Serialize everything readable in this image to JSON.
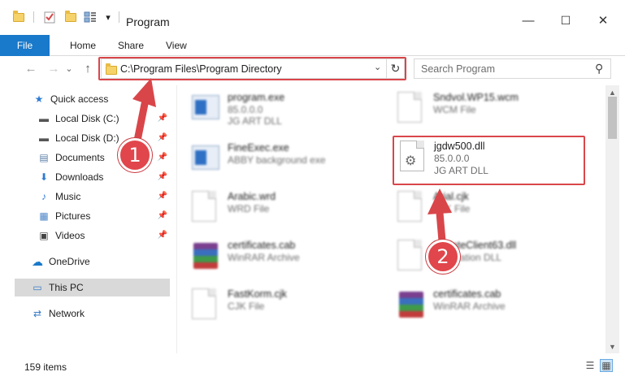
{
  "window": {
    "title": "Program",
    "minimize": "—",
    "maximize": "☐",
    "close": "✕"
  },
  "quick_access_toolbar": {
    "dropdown": "▾"
  },
  "ribbon": {
    "tabs": [
      "File",
      "Home",
      "Share",
      "View"
    ]
  },
  "navigation": {
    "back": "←",
    "forward": "→",
    "recent": "⌄",
    "up": "↑"
  },
  "address": {
    "path": "C:\\Program Files\\Program Directory",
    "dropdown": "⌄",
    "refresh": "↻"
  },
  "search": {
    "placeholder": "Search Program",
    "icon": "⚲"
  },
  "sidebar": {
    "items": [
      {
        "label": "Quick access",
        "icon": "star-icon",
        "glyph": "★",
        "pinned": false
      },
      {
        "label": "Local Disk (C:)",
        "icon": "drive-icon",
        "glyph": "▬",
        "pinned": true
      },
      {
        "label": "Local Disk (D:)",
        "icon": "drive-icon",
        "glyph": "▬",
        "pinned": true
      },
      {
        "label": "Documents",
        "icon": "documents-icon",
        "glyph": "▤",
        "pinned": true
      },
      {
        "label": "Downloads",
        "icon": "download-icon",
        "glyph": "⬇",
        "pinned": true
      },
      {
        "label": "Music",
        "icon": "music-icon",
        "glyph": "♪",
        "pinned": true
      },
      {
        "label": "Pictures",
        "icon": "pictures-icon",
        "glyph": "▦",
        "pinned": true
      },
      {
        "label": "Videos",
        "icon": "videos-icon",
        "glyph": "▣",
        "pinned": true
      },
      {
        "label": "OneDrive",
        "icon": "cloud-icon",
        "glyph": "☁",
        "pinned": false
      },
      {
        "label": "This PC",
        "icon": "computer-icon",
        "glyph": "▭",
        "pinned": false
      },
      {
        "label": "Network",
        "icon": "network-icon",
        "glyph": "⇄",
        "pinned": false
      }
    ],
    "pin_glyph": "📌"
  },
  "files": [
    {
      "name": "program.exe",
      "line1": "85.0.0.0",
      "line2": "JG ART DLL",
      "icon": "exe-icon"
    },
    {
      "name": "Sndvol.WP15.wcm",
      "line1": "WCM File",
      "line2": "",
      "icon": "file-icon"
    },
    {
      "name": "FineExec.exe",
      "line1": "ABBY background exe",
      "line2": "",
      "icon": "exe-icon"
    },
    {
      "name": "jgdw500.dll",
      "line1": "85.0.0.0",
      "line2": "JG ART DLL",
      "icon": "dll-icon"
    },
    {
      "name": "Arabic.wrd",
      "line1": "WRD File",
      "line2": "",
      "icon": "file-icon"
    },
    {
      "name": "Arial.cjk",
      "line1": "CJK File",
      "line2": "",
      "icon": "file-icon"
    },
    {
      "name": "certificates.cab",
      "line1": "WinRAR Archive",
      "line2": "",
      "icon": "rar-icon"
    },
    {
      "name": "UpdateClient63.dll",
      "line1": "Application DLL",
      "line2": "",
      "icon": "file-icon"
    },
    {
      "name": "FastKorm.cjk",
      "line1": "CJK File",
      "line2": "",
      "icon": "file-icon"
    },
    {
      "name": "certificates.cab",
      "line1": "WinRAR Archive",
      "line2": "",
      "icon": "rar-icon"
    }
  ],
  "status": {
    "item_count": "159 items",
    "details_view": "☰",
    "tiles_view": "▦"
  },
  "annotations": {
    "step1": "1",
    "step2": "2",
    "color": "#d9464a"
  },
  "colors": {
    "accent": "#1979ca",
    "selection": "#d9d9d9"
  }
}
